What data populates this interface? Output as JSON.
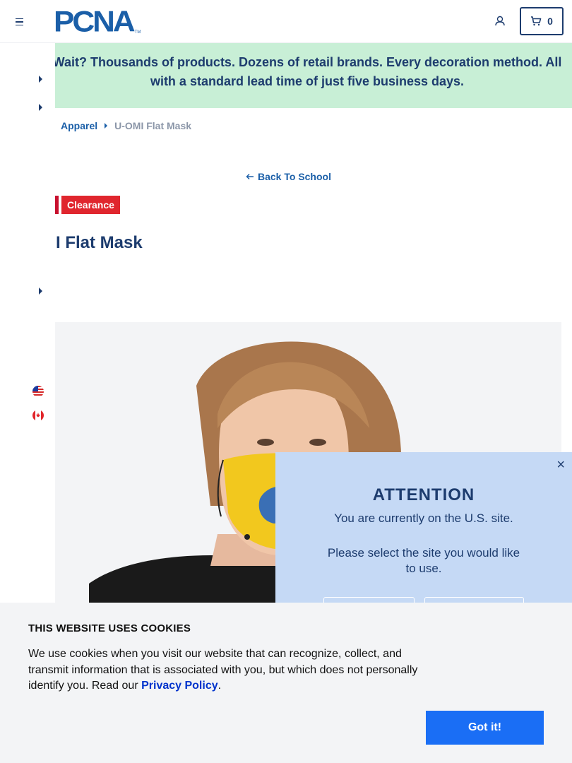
{
  "header": {
    "logo_text": "PCNA",
    "logo_tm": "TM",
    "cart_count": "0"
  },
  "banner": {
    "text": "Wait? Thousands of products. Dozens of retail brands. Every decoration method. All with a standard lead time of just five business days."
  },
  "breadcrumb": {
    "items": [
      "Apparel"
    ],
    "current": "U-OMI Flat Mask"
  },
  "back_link": {
    "label": "Back To School"
  },
  "badge": {
    "label": "Clearance"
  },
  "product": {
    "title": "I Flat Mask"
  },
  "attention": {
    "title": "ATTENTION",
    "line1": "You are currently on the U.S. site.",
    "line2": "Please select the site you would like to use.",
    "close": "×"
  },
  "cookie": {
    "title": "THIS WEBSITE USES COOKIES",
    "body": "We use cookies when you visit our website that can recognize, collect, and transmit information that is associated with you, but which does not personally identify you. Read our ",
    "link": "Privacy Policy",
    "period": ".",
    "button": "Got it!"
  },
  "colors": {
    "navy": "#1d3c6e",
    "brand_blue": "#1b5fa8",
    "banner_bg": "#c8efd6",
    "clearance_red": "#e0262e",
    "attention_bg": "#c5d9f5",
    "cookie_button": "#1a6ef5"
  },
  "icons": [
    "menu-icon",
    "user-icon",
    "cart-icon",
    "arrow-left-icon",
    "us-flag-icon",
    "canada-flag-icon",
    "close-icon"
  ]
}
